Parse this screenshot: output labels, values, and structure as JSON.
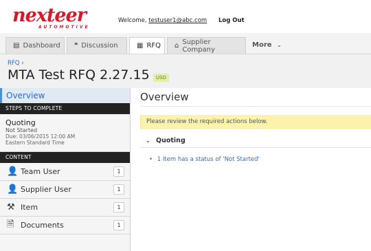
{
  "header": {
    "logo_text": "nexteer",
    "logo_sub": "AUTOMOTIVE",
    "welcome_prefix": "Welcome,",
    "user_email": "testuser1@abc.com",
    "logout_label": "Log Out"
  },
  "tabs": [
    {
      "label": "Dashboard",
      "icon": "dashboard-icon",
      "glyph": "▤"
    },
    {
      "label": "Discussion",
      "icon": "discussion-icon",
      "glyph": "💬"
    },
    {
      "label": "RFQ",
      "icon": "rfq-icon",
      "glyph": "▦"
    },
    {
      "label": "Supplier Company",
      "icon": "factory-icon",
      "glyph": "⌂"
    }
  ],
  "more_label": "More",
  "breadcrumb": {
    "label": "RFQ",
    "sep": "›"
  },
  "rfq": {
    "title": "MTA Test RFQ 2.27.15",
    "currency": "USD"
  },
  "sidebar": {
    "overview_label": "Overview",
    "steps_header": "STEPS TO COMPLETE",
    "step": {
      "name": "Quoting",
      "status": "Not Started",
      "due": "Due: 03/06/2015 12:00 AM",
      "tz": "Eastern Standard Time"
    },
    "content_header": "CONTENT",
    "items": [
      {
        "label": "Team User",
        "count": "1",
        "icon": "user-icon"
      },
      {
        "label": "Supplier User",
        "count": "1",
        "icon": "supplier-user-icon"
      },
      {
        "label": "Item",
        "count": "1",
        "icon": "hammer-icon"
      },
      {
        "label": "Documents",
        "count": "1",
        "icon": "document-icon"
      }
    ]
  },
  "main": {
    "title": "Overview",
    "alert": "Please review the required actions below.",
    "section_title": "Quoting",
    "action_item": "1 Item has a status of 'Not Started'"
  },
  "colors": {
    "brand": "#d6182a",
    "link": "#2a6ebf",
    "alert_bg": "#fbf3ab",
    "badge_bg": "#dff0a8"
  }
}
